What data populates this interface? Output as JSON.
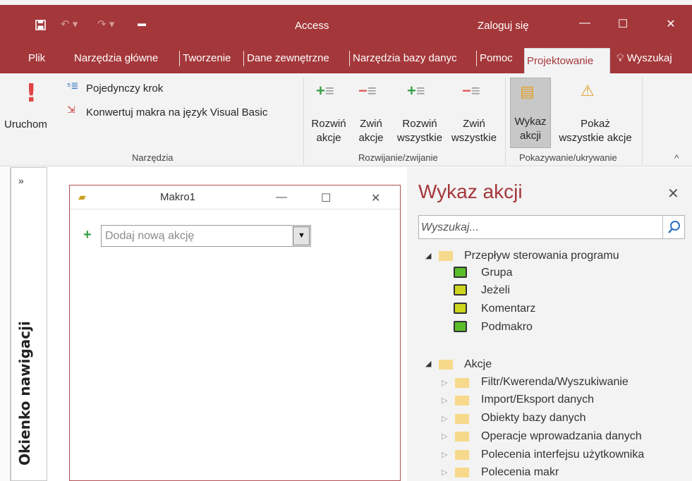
{
  "quick_access": {
    "save_icon": "save-icon",
    "undo_icon": "undo-icon",
    "redo_icon": "redo-icon",
    "customize_icon": "customize-qat-icon"
  },
  "window": {
    "title": "Access",
    "signin": "Zaloguj się",
    "minimize": "—",
    "maximize": "☐",
    "close": "✕"
  },
  "tabs": {
    "items": [
      "Plik",
      "Narzędzia główne",
      "Tworzenie",
      "Dane zewnętrzne",
      "Narzędzia bazy danyc",
      "Pomoc"
    ],
    "active": "Projektowanie",
    "search": "Wyszukaj"
  },
  "ribbon": {
    "run_label": "Uruchom",
    "single_step": "Pojedynczy krok",
    "convert": "Konwertuj makra na język Visual Basic",
    "group_tools": "Narzędzia",
    "expand_actions_1": "Rozwiń",
    "expand_actions_2": "akcje",
    "collapse_actions_1": "Zwiń",
    "collapse_actions_2": "akcje",
    "expand_all_1": "Rozwiń",
    "expand_all_2": "wszystkie",
    "collapse_all_1": "Zwiń",
    "collapse_all_2": "wszystkie",
    "group_expand": "Rozwijanie/zwijanie",
    "catalog_1": "Wykaz",
    "catalog_2": "akcji",
    "show_all_1": "Pokaż",
    "show_all_2": "wszystkie akcje",
    "group_show": "Pokazywanie/ukrywanie",
    "collapse_ribbon": "^"
  },
  "nav": {
    "chevron": "»",
    "label": "Okienko nawigacji"
  },
  "macro": {
    "title": "Makro1",
    "add_action": "Dodaj nową akcję",
    "plus": "+",
    "minimize": "—",
    "maximize": "☐",
    "close": "✕"
  },
  "catalog": {
    "title": "Wykaz akcji",
    "close": "✕",
    "search_placeholder": "Wyszukaj...",
    "flow_label": "Przepływ sterowania programu",
    "flow_items": [
      "Grupa",
      "Jeżeli",
      "Komentarz",
      "Podmakro"
    ],
    "actions_label": "Akcje",
    "action_items": [
      "Filtr/Kwerenda/Wyszukiwanie",
      "Import/Eksport danych",
      "Obiekty bazy danych",
      "Operacje wprowadzania danych",
      "Polecenia interfejsu użytkownika",
      "Polecenia makr"
    ]
  }
}
